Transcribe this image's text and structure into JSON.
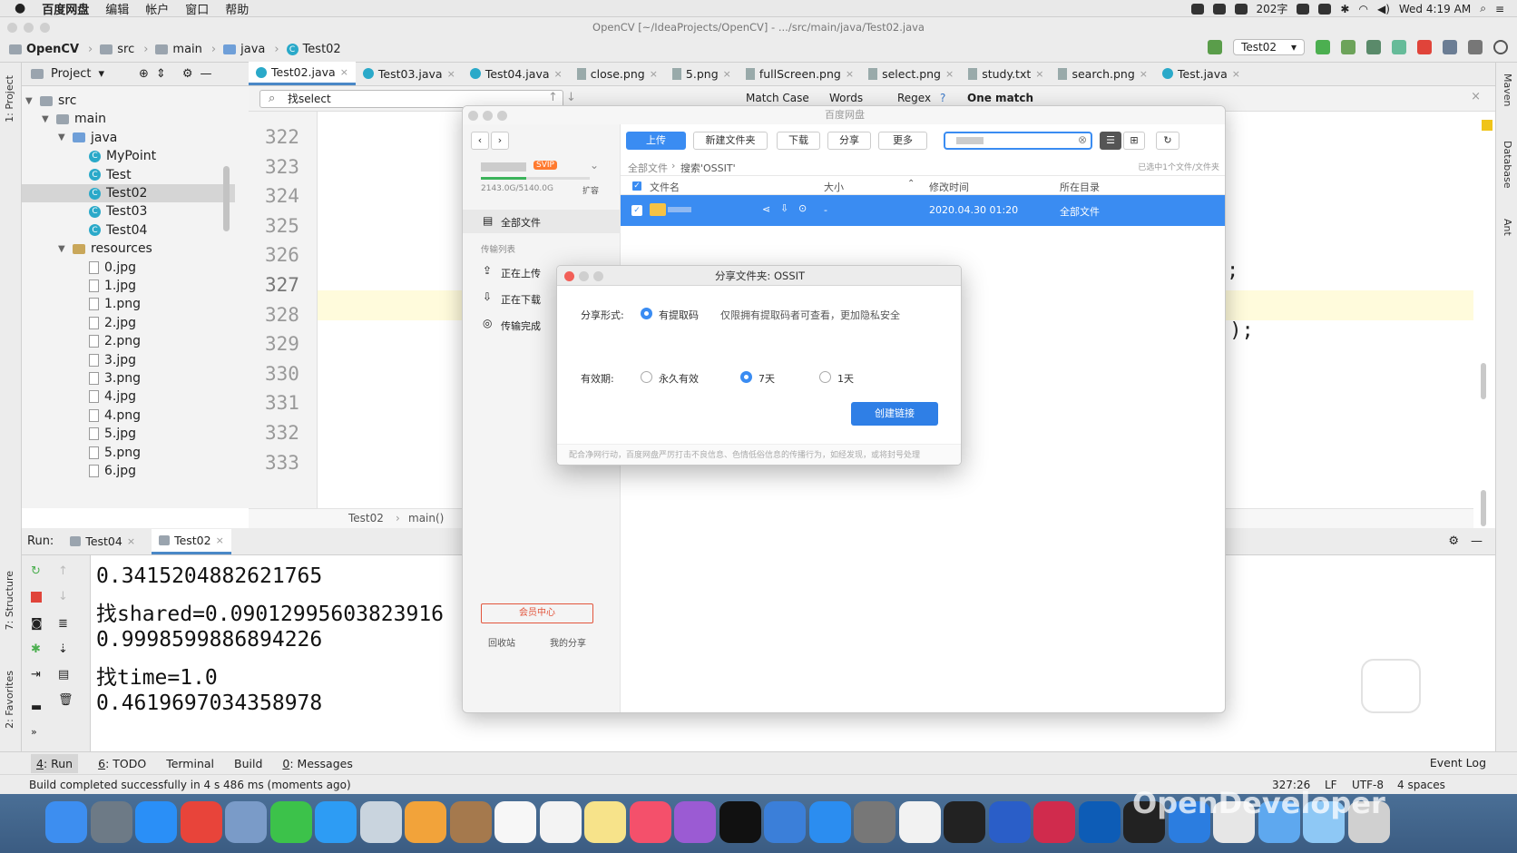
{
  "menubar": {
    "app": "百度网盘",
    "items": [
      "编辑",
      "帐户",
      "窗口",
      "帮助"
    ],
    "battery": "202字",
    "clock": "Wed 4:19 AM"
  },
  "window_title": "OpenCV [~/IdeaProjects/OpenCV] - .../src/main/java/Test02.java",
  "nav": {
    "project": "OpenCV",
    "crumbs": [
      "src",
      "main",
      "java"
    ],
    "file": "Test02",
    "run_config": "Test02"
  },
  "left_strip": {
    "project": "1: Project",
    "structure": "7: Structure",
    "favorites": "2: Favorites"
  },
  "right_strip": {
    "maven": "Maven",
    "database": "Database",
    "ant": "Ant"
  },
  "project_panel": {
    "title": "Project"
  },
  "tree": [
    {
      "label": "src",
      "depth": 0,
      "type": "folder",
      "arrow": "▼"
    },
    {
      "label": "main",
      "depth": 1,
      "type": "folder",
      "arrow": "▼"
    },
    {
      "label": "java",
      "depth": 2,
      "type": "folder",
      "arrow": "▼"
    },
    {
      "label": "MyPoint",
      "depth": 3,
      "type": "class"
    },
    {
      "label": "Test",
      "depth": 3,
      "type": "class"
    },
    {
      "label": "Test02",
      "depth": 3,
      "type": "class",
      "selected": true
    },
    {
      "label": "Test03",
      "depth": 3,
      "type": "class"
    },
    {
      "label": "Test04",
      "depth": 3,
      "type": "class"
    },
    {
      "label": "resources",
      "depth": 2,
      "type": "folder",
      "arrow": "▼"
    },
    {
      "label": "0.jpg",
      "depth": 3,
      "type": "file"
    },
    {
      "label": "1.jpg",
      "depth": 3,
      "type": "file"
    },
    {
      "label": "1.png",
      "depth": 3,
      "type": "file"
    },
    {
      "label": "2.jpg",
      "depth": 3,
      "type": "file"
    },
    {
      "label": "2.png",
      "depth": 3,
      "type": "file"
    },
    {
      "label": "3.jpg",
      "depth": 3,
      "type": "file"
    },
    {
      "label": "3.png",
      "depth": 3,
      "type": "file"
    },
    {
      "label": "4.jpg",
      "depth": 3,
      "type": "file"
    },
    {
      "label": "4.png",
      "depth": 3,
      "type": "file"
    },
    {
      "label": "5.jpg",
      "depth": 3,
      "type": "file"
    },
    {
      "label": "5.png",
      "depth": 3,
      "type": "file"
    },
    {
      "label": "6.jpg",
      "depth": 3,
      "type": "file"
    }
  ],
  "tabs": [
    {
      "label": "Test02.java",
      "icon": "class",
      "active": true
    },
    {
      "label": "Test03.java",
      "icon": "class"
    },
    {
      "label": "Test04.java",
      "icon": "class"
    },
    {
      "label": "close.png",
      "icon": "file"
    },
    {
      "label": "5.png",
      "icon": "file"
    },
    {
      "label": "fullScreen.png",
      "icon": "file"
    },
    {
      "label": "select.png",
      "icon": "file"
    },
    {
      "label": "study.txt",
      "icon": "file"
    },
    {
      "label": "search.png",
      "icon": "file"
    },
    {
      "label": "Test.java",
      "icon": "class"
    }
  ],
  "find": {
    "query": "找select",
    "match_case": "Match Case",
    "words": "Words",
    "regex": "Regex",
    "regex_help": "?",
    "result": "One match"
  },
  "editor": {
    "line_numbers": [
      "322",
      "323",
      "324",
      "325",
      "326",
      "327",
      "328",
      "329",
      "330",
      "331",
      "332",
      "333"
    ],
    "current_line": "327",
    "fragments": [
      ";",
      "');"
    ],
    "breadcrumb": [
      "Test02",
      "main()"
    ]
  },
  "run": {
    "label": "Run:",
    "tabs": [
      "Test04",
      "Test02"
    ],
    "output": [
      "0.3415204882621765",
      "找shared=0.09012995603823916",
      "0.9998599886894226",
      "找time=1.0",
      "0.4619697034358978"
    ]
  },
  "bottom_tools": [
    {
      "key": "4",
      "label": ": Run"
    },
    {
      "key": "6",
      "label": ": TODO"
    },
    {
      "key": "",
      "label": "Terminal"
    },
    {
      "key": "",
      "label": "Build"
    },
    {
      "key": "0",
      "label": ": Messages"
    }
  ],
  "event_log": "Event Log",
  "status": {
    "message": "Build completed successfully in 4 s 486 ms (moments ago)",
    "position": "327:26",
    "line_sep": "LF",
    "encoding": "UTF-8",
    "indent": "4 spaces"
  },
  "baidu": {
    "title": "百度网盘",
    "quota": "2143.0G/5140.0G",
    "expand": "扩容",
    "svip": "SVIP",
    "toolbar": {
      "upload": "上传",
      "new_folder": "新建文件夹",
      "download": "下载",
      "share": "分享",
      "more": "更多"
    },
    "sidebar": {
      "all_files": "全部文件",
      "transfer_list": "传输列表",
      "uploading": "正在上传",
      "downloading": "正在下载",
      "done": "传输完成",
      "vip": "会员中心",
      "recycle": "回收站",
      "my_share": "我的分享"
    },
    "breadcrumb": [
      "全部文件",
      "搜索'OSSIT'"
    ],
    "selected_info": "已选中1个文件/文件夹",
    "columns": [
      "文件名",
      "大小",
      "修改时间",
      "所在目录"
    ],
    "row": {
      "size": "-",
      "modified": "2020.04.30 01:20",
      "dir": "全部文件"
    }
  },
  "share_dialog": {
    "title": "分享文件夹: OSSIT",
    "form_label": "分享形式:",
    "form_option": "有提取码",
    "form_desc": "仅限拥有提取码者可查看，更加隐私安全",
    "valid_label": "有效期:",
    "options": [
      "永久有效",
      "7天",
      "1天"
    ],
    "selected": "7天",
    "create": "创建链接",
    "footer": "配合净网行动，百度网盘严厉打击不良信息、色情低俗信息的传播行为，如经发现，或将封号处理"
  },
  "watermark": "OpenDeveloper",
  "colors": {
    "accent": "#3a8cf2",
    "ij_blue": "#4a88c7"
  }
}
